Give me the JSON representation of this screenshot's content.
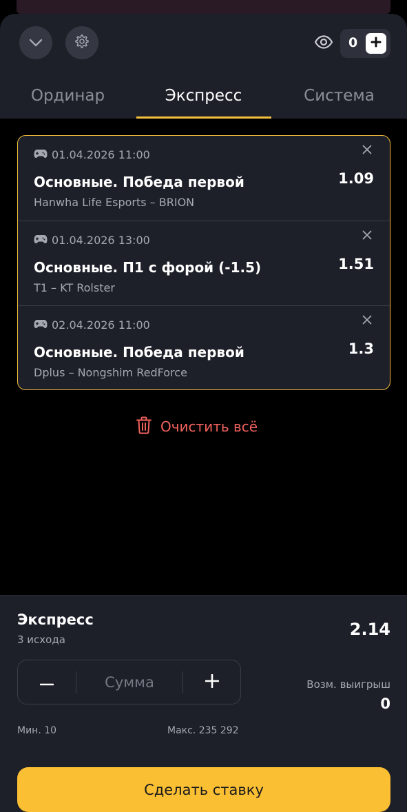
{
  "header": {
    "counter_value": "0"
  },
  "tabs": [
    {
      "label": "Ординар"
    },
    {
      "label": "Экспресс"
    },
    {
      "label": "Система"
    }
  ],
  "bets": [
    {
      "datetime": "01.04.2026 11:00",
      "market": "Основные. Победа первой",
      "teams": "Hanwha Life Esports – BRION",
      "odds": "1.09"
    },
    {
      "datetime": "01.04.2026 13:00",
      "market": "Основные. П1 с форой (-1.5)",
      "teams": "T1 – KT Rolster",
      "odds": "1.51"
    },
    {
      "datetime": "02.04.2026 11:00",
      "market": "Основные. Победа первой",
      "teams": "Dplus – Nongshim RedForce",
      "odds": "1.3"
    }
  ],
  "clear_all_label": "Очистить всё",
  "summary": {
    "title": "Экспресс",
    "outcomes": "3 исхода",
    "total_odds": "2.14",
    "stake_placeholder": "Сумма",
    "min_label": "Мин. 10",
    "max_label": "Макс. 235 292",
    "win_label": "Возм. выигрыш",
    "win_value": "0"
  },
  "submit_label": "Сделать ставку",
  "colors": {
    "accent": "#fbbf34",
    "danger": "#f0625e",
    "panel": "#1e2029"
  },
  "icons": [
    "chevron-down-icon",
    "gear-icon",
    "eye-icon",
    "plus-icon",
    "gamepad-icon",
    "close-icon",
    "trash-icon",
    "minus-icon"
  ]
}
